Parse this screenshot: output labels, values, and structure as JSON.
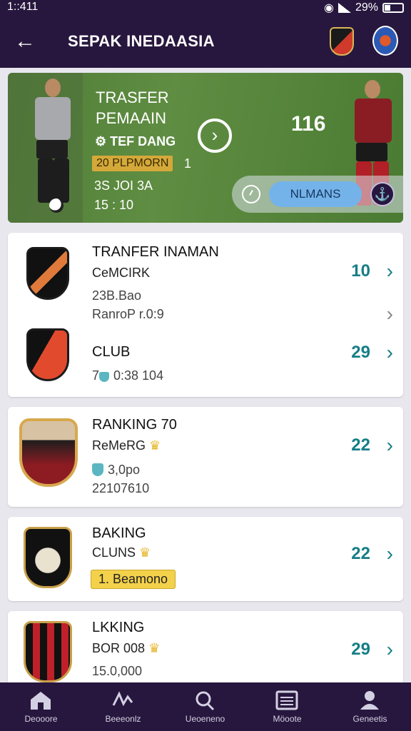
{
  "status": {
    "time": "1::411",
    "battery": "29%"
  },
  "app_bar": {
    "back_icon": "back-arrow-icon",
    "title": "SEPAK INEDAASIA"
  },
  "hero": {
    "title_line1": "TRASFER",
    "title_line2": "PEMAAIN",
    "subtitle": "TEF DANG",
    "tag": "20 PLPMORN",
    "tag_suffix": "1",
    "line1": "3S JOI 3A",
    "line2": "15 : 10",
    "score": "116",
    "pill_button": "NLMANS"
  },
  "card1": {
    "row1": {
      "title": "TRANFER INAMAN",
      "sub": "CeMCIRK",
      "meta1": "23B.Bao",
      "meta2": "RanroP r.0:9",
      "value": "10"
    },
    "row2": {
      "title": "CLUB",
      "meta": "7ℹ 0:38 104",
      "meta_num": "7",
      "meta_rest": "0:38 104",
      "value": "29"
    }
  },
  "card2": {
    "title": "RANKING 70",
    "sub": "ReMeRG",
    "meta1": "3,0po",
    "meta2": "22107610",
    "value": "22"
  },
  "card3": {
    "title": "BAKING",
    "sub": "CLUNS",
    "badge": "1. Beamono",
    "value": "22"
  },
  "card4": {
    "title": "LKKING",
    "sub": "BOR 008",
    "meta": "15.0,000",
    "value": "29"
  },
  "bottom_nav": [
    {
      "label": "Deooore",
      "icon": "home-icon"
    },
    {
      "label": "Beeeonlz",
      "icon": "stats-icon"
    },
    {
      "label": "Ueoeneno",
      "icon": "search-icon"
    },
    {
      "label": "Möoote",
      "icon": "list-icon"
    },
    {
      "label": "Geneetis",
      "icon": "profile-icon"
    }
  ],
  "colors": {
    "header": "#27173e",
    "accent": "#167e86",
    "pill": "#74b3ea",
    "tag": "#d4a93a"
  }
}
